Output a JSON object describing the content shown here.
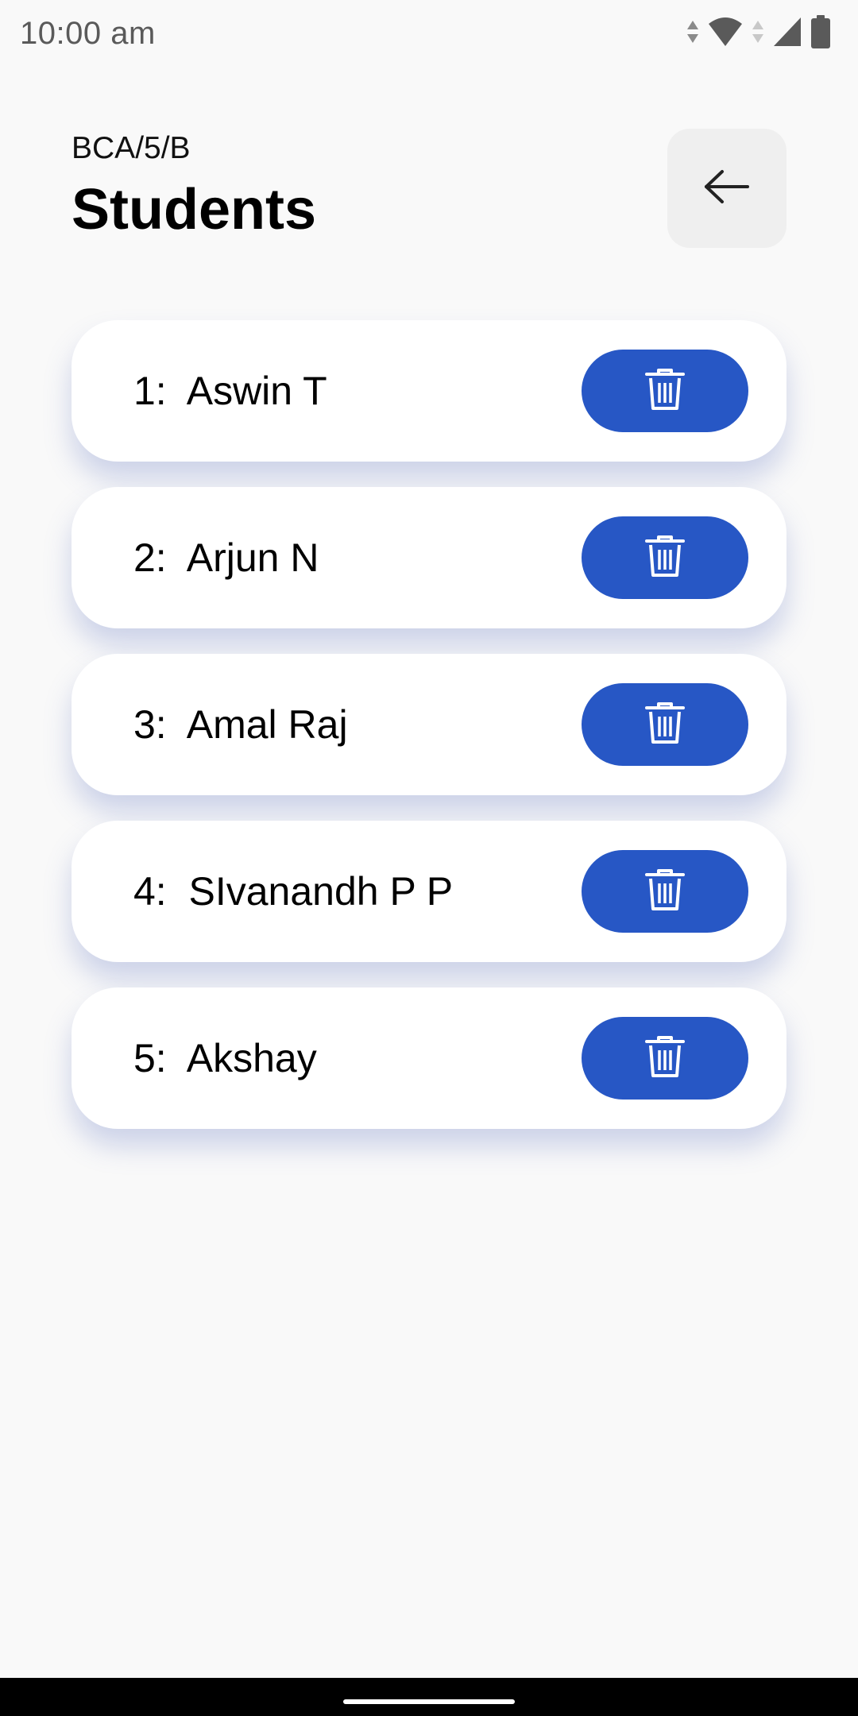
{
  "status_bar": {
    "time": "10:00 am",
    "icons": [
      "data-arrows-icon",
      "wifi-icon",
      "data-arrows-icon",
      "cell-signal-icon",
      "battery-icon"
    ]
  },
  "header": {
    "subtitle": "BCA/5/B",
    "title": "Students"
  },
  "back_button": {
    "icon": "arrow-left-icon"
  },
  "students": [
    {
      "label": "1:  Aswin T"
    },
    {
      "label": "2:  Arjun N"
    },
    {
      "label": "3:  Amal Raj"
    },
    {
      "label": "4:  SIvanandh P P"
    },
    {
      "label": "5:  Akshay"
    }
  ],
  "delete_button": {
    "icon": "trash-icon"
  },
  "colors": {
    "background": "#f9f9f9",
    "accent": "#2757c5",
    "card": "#ffffff",
    "back_button_bg": "#efefef"
  }
}
